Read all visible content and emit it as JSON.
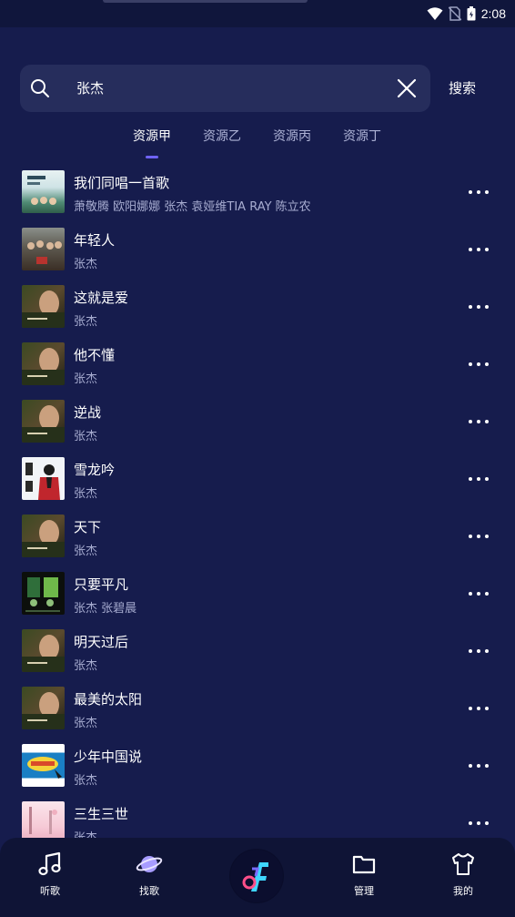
{
  "status_bar": {
    "time": "2:08"
  },
  "search": {
    "query": "张杰",
    "button_label": "搜索"
  },
  "tabs": [
    {
      "label": "资源甲",
      "active": true
    },
    {
      "label": "资源乙",
      "active": false
    },
    {
      "label": "资源丙",
      "active": false
    },
    {
      "label": "资源丁",
      "active": false
    }
  ],
  "songs": [
    {
      "title": "我们同唱一首歌",
      "artist": "萧敬腾  欧阳娜娜  张杰  袁娅维TIA RAY  陈立农",
      "cover": "cover-group-song"
    },
    {
      "title": "年轻人",
      "artist": "张杰",
      "cover": "cover-crowd"
    },
    {
      "title": "这就是爱",
      "artist": "张杰",
      "cover": "cover-portrait"
    },
    {
      "title": "他不懂",
      "artist": "张杰",
      "cover": "cover-portrait"
    },
    {
      "title": "逆战",
      "artist": "张杰",
      "cover": "cover-portrait"
    },
    {
      "title": "雪龙吟",
      "artist": "张杰",
      "cover": "cover-snow-dragon"
    },
    {
      "title": "天下",
      "artist": "张杰",
      "cover": "cover-portrait"
    },
    {
      "title": "只要平凡",
      "artist": "张杰  张碧晨",
      "cover": "cover-film"
    },
    {
      "title": "明天过后",
      "artist": "张杰",
      "cover": "cover-portrait"
    },
    {
      "title": "最美的太阳",
      "artist": "张杰",
      "cover": "cover-portrait"
    },
    {
      "title": "少年中国说",
      "artist": "张杰",
      "cover": "cover-youth-china"
    },
    {
      "title": "三生三世",
      "artist": "张杰",
      "cover": "cover-pink"
    }
  ],
  "nav": {
    "listen": "听歌",
    "discover": "找歌",
    "manage": "管理",
    "mine": "我的"
  },
  "colors": {
    "background": "#161c4d",
    "search_box": "#262d5c",
    "accent": "#6f63f6",
    "nav_bar": "#0f1436"
  }
}
